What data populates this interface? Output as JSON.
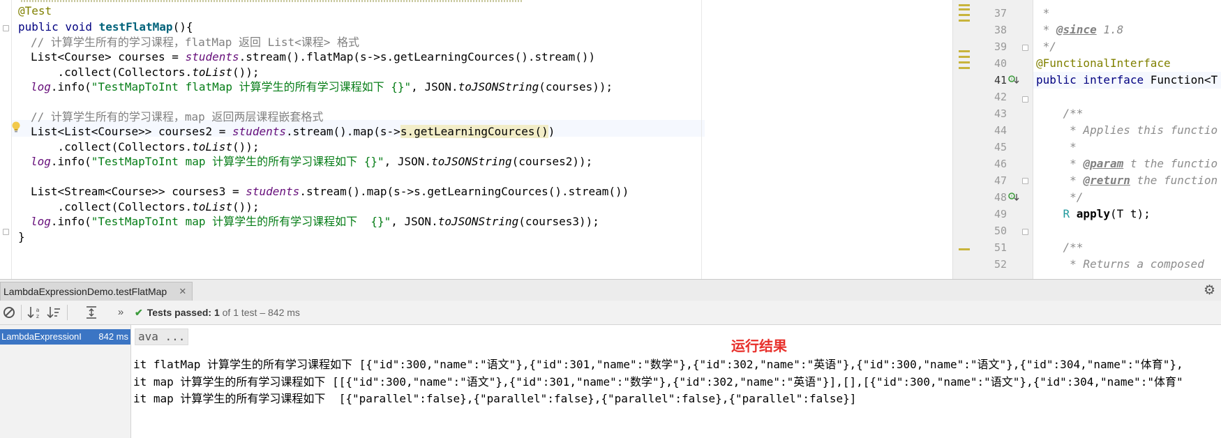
{
  "left_code": {
    "line_annotation": "@Test",
    "line_signature": {
      "kw": "public void ",
      "name": "testFlatMap",
      "rest": "(){"
    },
    "line_comment1": "// 计算学生所有的学习课程，flatMap 返回 List<课程> 格式",
    "line_courses_a": {
      "p1": "List<Course> courses = ",
      "field": "students",
      "p2": ".stream().flatMap(s->s.getLearningCources().stream())"
    },
    "line_courses_b": {
      "p1": "    .collect(Collectors.",
      "stat": "toList",
      "p2": "());"
    },
    "line_courses_c": {
      "field": "log",
      "p1": ".info(",
      "str": "\"TestMapToInt flatMap 计算学生的所有学习课程如下 {}\"",
      "p2": ", JSON.",
      "stat": "toJSONString",
      "p3": "(courses));"
    },
    "line_comment2": "// 计算学生所有的学习课程，map 返回两层课程嵌套格式",
    "line_courses2_a": {
      "p1": "List<List<Course>> courses2 = ",
      "field": "students",
      "p2": ".stream().map(s->",
      "hl": "s.getLearningCources()",
      "p3": ")"
    },
    "line_courses2_b": {
      "p1": "    .collect(Collectors.",
      "stat": "toList",
      "p2": "());"
    },
    "line_courses2_c": {
      "field": "log",
      "p1": ".info(",
      "str": "\"TestMapToInt map 计算学生的所有学习课程如下 {}\"",
      "p2": ", JSON.",
      "stat": "toJSONString",
      "p3": "(courses2));"
    },
    "line_courses3_a": {
      "p1": "List<Stream<Course>> courses3 = ",
      "field": "students",
      "p2": ".stream().map(s->s.getLearningCources().stream())"
    },
    "line_courses3_b": {
      "p1": "    .collect(Collectors.",
      "stat": "toList",
      "p2": "());"
    },
    "line_courses3_c": {
      "field": "log",
      "p1": ".info(",
      "str": "\"TestMapToInt map 计算学生的所有学习课程如下  {}\"",
      "p2": ", JSON.",
      "stat": "toJSONString",
      "p3": "(courses3));"
    },
    "line_close": "}"
  },
  "right_code": {
    "line_numbers": [
      "37",
      "38",
      "39",
      "40",
      "41",
      "42",
      "43",
      "44",
      "45",
      "46",
      "47",
      "48",
      "49",
      "50",
      "51",
      "52"
    ],
    "l37": " *",
    "l38": {
      "a": " * ",
      "tag": "@since",
      "b": " 1.8"
    },
    "l39": " */",
    "l40": "@FunctionalInterface",
    "l41": {
      "kw": "public interface ",
      "name": "Function<T"
    },
    "l43": "    /**",
    "l44": "     * Applies this functio",
    "l45": "     *",
    "l46": {
      "a": "     * ",
      "tag": "@param",
      "b": " t the functio"
    },
    "l47": {
      "a": "     * ",
      "tag": "@return",
      "b": " the function"
    },
    "l48": "     */",
    "l49": {
      "t1": "    R ",
      "name": "apply",
      "t2": "(T t);"
    },
    "l51": "    /**",
    "l52": "     * Returns a composed"
  },
  "run_panel": {
    "tab_label": "LambdaExpressionDemo.testFlatMap",
    "tab_close": "✕",
    "status_label": "Tests passed: 1",
    "status_rest": " of 1 test – 842 ms",
    "tree_item_name": "LambdaExpressionI",
    "tree_item_time": "842 ms",
    "cmd_line": "ava ...",
    "run_result_label": "运行结果",
    "console_lines": [
      "it flatMap 计算学生的所有学习课程如下 [{\"id\":300,\"name\":\"语文\"},{\"id\":301,\"name\":\"数学\"},{\"id\":302,\"name\":\"英语\"},{\"id\":300,\"name\":\"语文\"},{\"id\":304,\"name\":\"体育\"},",
      "it map 计算学生的所有学习课程如下 [[{\"id\":300,\"name\":\"语文\"},{\"id\":301,\"name\":\"数学\"},{\"id\":302,\"name\":\"英语\"}],[],[{\"id\":300,\"name\":\"语文\"},{\"id\":304,\"name\":\"体育\"",
      "it map 计算学生的所有学习课程如下  [{\"parallel\":false},{\"parallel\":false},{\"parallel\":false},{\"parallel\":false}]"
    ]
  },
  "icons": [
    "fold-marker-icon",
    "bulb-icon",
    "implementation-icon",
    "gear-icon",
    "stop-icon",
    "sort-alpha-icon",
    "sort-duration-icon",
    "expand-all-icon",
    "more-icon",
    "check-icon"
  ],
  "colors": {
    "accent_selection": "#3b75c4",
    "passed_green": "#3c9b3c",
    "result_red": "#e8302b",
    "keyword": "#000080",
    "string": "#067d17"
  }
}
